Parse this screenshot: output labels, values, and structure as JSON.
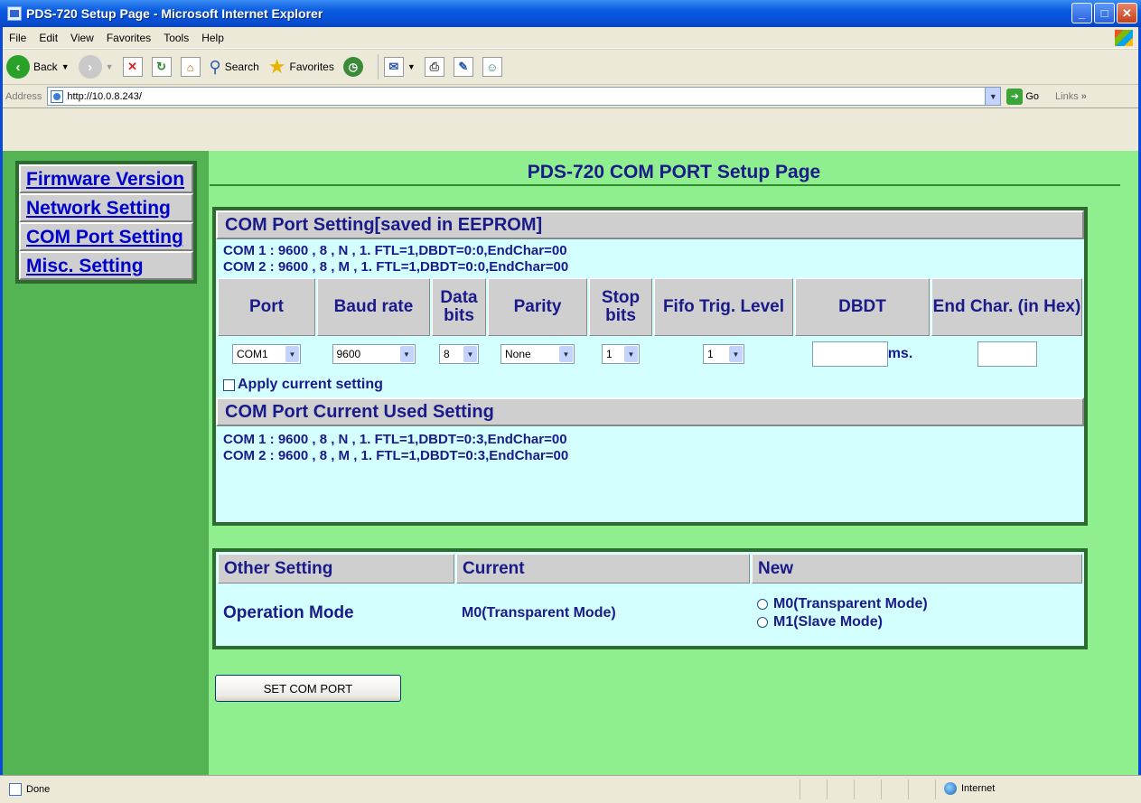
{
  "window": {
    "title": "PDS-720 Setup Page - Microsoft Internet Explorer"
  },
  "menu": [
    "File",
    "Edit",
    "View",
    "Favorites",
    "Tools",
    "Help"
  ],
  "toolbar": {
    "back_label": "Back",
    "search_label": "Search",
    "favorites_label": "Favorites"
  },
  "address": {
    "label": "Address",
    "url": "http://10.0.8.243/",
    "go_label": "Go",
    "links_label": "Links"
  },
  "nav": [
    {
      "label": "Firmware Version"
    },
    {
      "label": "Network Setting"
    },
    {
      "label": "COM Port Setting"
    },
    {
      "label": "Misc. Setting"
    }
  ],
  "page": {
    "title": "PDS-720 COM PORT Setup Page"
  },
  "com_saved": {
    "header": "COM Port Setting[saved in EEPROM]",
    "lines": [
      "COM 1 : 9600 , 8 , N , 1. FTL=1,DBDT=0:0,EndChar=00",
      "COM 2 : 9600 , 8 , M , 1. FTL=1,DBDT=0:0,EndChar=00"
    ]
  },
  "settings_table": {
    "headers": [
      "Port",
      "Baud rate",
      "Data bits",
      "Parity",
      "Stop bits",
      "Fifo Trig. Level",
      "DBDT",
      "End Char. (in Hex)"
    ],
    "values": {
      "port": "COM1",
      "baud": "9600",
      "data_bits": "8",
      "parity": "None",
      "stop_bits": "1",
      "fifo": "1",
      "dbdt": "",
      "end_char": ""
    },
    "dbdt_unit": "ms."
  },
  "apply": {
    "label": "Apply current setting"
  },
  "com_current": {
    "header": "COM Port Current Used Setting",
    "lines": [
      "COM 1 : 9600 , 8 , N , 1. FTL=1,DBDT=0:3,EndChar=00",
      "COM 2 : 9600 , 8 , M , 1. FTL=1,DBDT=0:3,EndChar=00"
    ]
  },
  "other": {
    "headers": [
      "Other Setting",
      "Current",
      "New"
    ],
    "row_label": "Operation Mode",
    "current_value": "M0(Transparent Mode)",
    "options": [
      "M0(Transparent Mode)",
      "M1(Slave Mode)"
    ]
  },
  "set_button": {
    "label": "SET COM PORT"
  },
  "status": {
    "text": "Done",
    "zone": "Internet"
  }
}
